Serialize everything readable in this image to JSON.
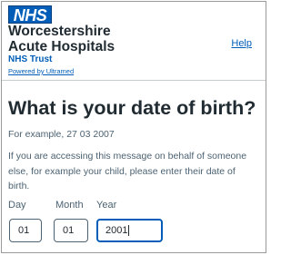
{
  "header": {
    "logo_text": "NHS",
    "org_name_line1": "Worcestershire",
    "org_name_line2": "Acute Hospitals",
    "org_subtitle": "NHS Trust",
    "powered_by": "Powered by Ultramed",
    "help_link": "Help"
  },
  "main": {
    "title": "What is your date of birth?",
    "hint": "For example, 27 03 2007",
    "body_line1": "If you are accessing this message on behalf of someone",
    "body_line2": "else, for example your child, please enter their date of",
    "body_line3": "birth."
  },
  "dob": {
    "day_label": "Day",
    "month_label": "Month",
    "year_label": "Year",
    "day_value": "01",
    "month_value": "01",
    "year_value": "2001"
  },
  "colors": {
    "brand_blue": "#005eb8",
    "text": "#212b32",
    "secondary_text": "#4c6272"
  }
}
